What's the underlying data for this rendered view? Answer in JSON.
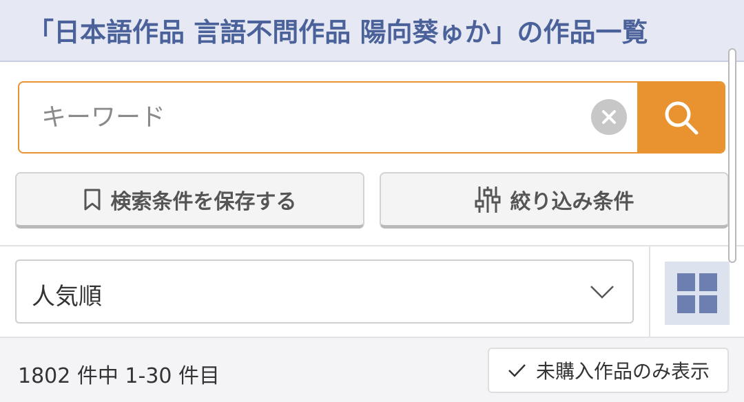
{
  "header": {
    "title": "「日本語作品 言語不問作品 陽向葵ゅか」の作品一覧"
  },
  "search": {
    "placeholder": "キーワード",
    "value": "",
    "accent_color": "#e8932f"
  },
  "actions": {
    "save_label": "検索条件を保存する",
    "filter_label": "絞り込み条件"
  },
  "sort": {
    "selected": "人気順"
  },
  "results": {
    "count_text": "1802 件中 1-30 件目",
    "unpurchased_label": "未購入作品のみ表示"
  },
  "icons": {
    "clear": "close-circle-icon",
    "search": "magnifier-icon",
    "bookmark": "bookmark-icon",
    "filter": "sliders-icon",
    "chevron": "chevron-down-icon",
    "grid": "grid-view-icon",
    "check": "checkmark-icon"
  },
  "colors": {
    "header_bg": "#e6e9f4",
    "header_text": "#4a6199",
    "grid_icon": "#6d7fb0"
  }
}
